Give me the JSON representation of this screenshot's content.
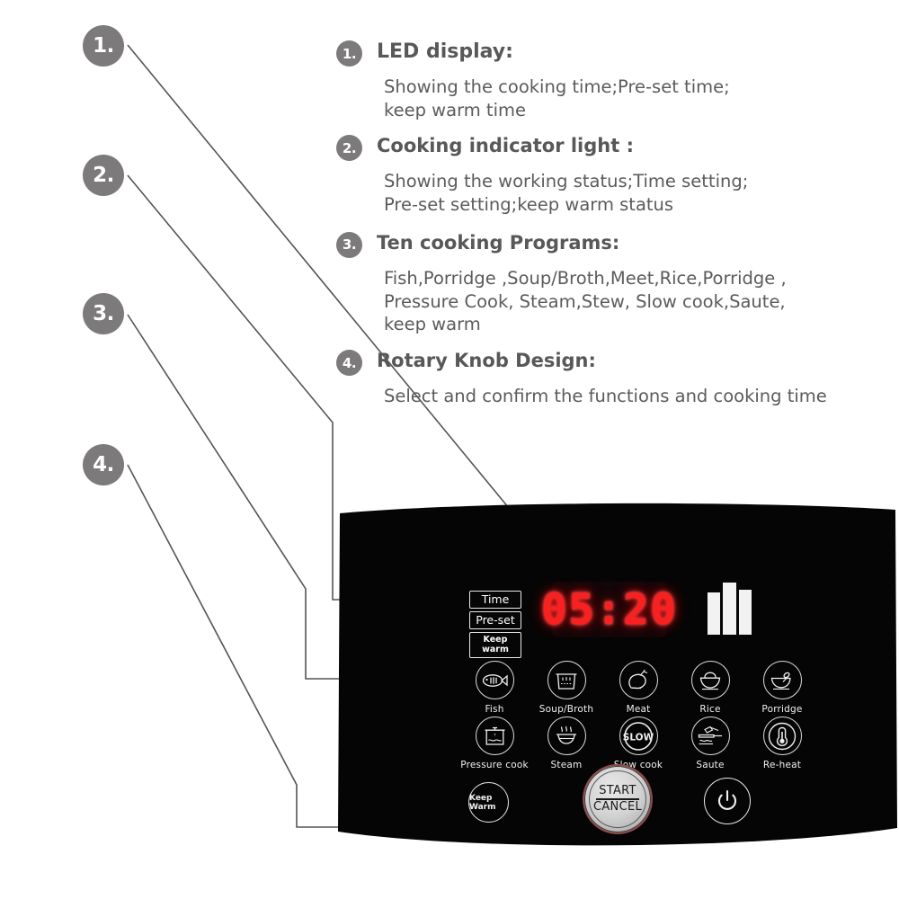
{
  "markers": [
    {
      "id": "marker-1",
      "label": "1."
    },
    {
      "id": "marker-2",
      "label": "2."
    },
    {
      "id": "marker-3",
      "label": "3."
    },
    {
      "id": "marker-4",
      "label": "4."
    }
  ],
  "features": [
    {
      "number": "1.",
      "title": "LED display:",
      "description": "Showing the cooking time;Pre-set time;\nkeep warm time"
    },
    {
      "number": "2.",
      "title": "Cooking indicator light :",
      "description": "Showing the  working status;Time setting;\nPre-set setting;keep warm status"
    },
    {
      "number": "3.",
      "title": "Ten cooking  Programs:",
      "description": "Fish,Porridge ,Soup/Broth,Meet,Rice,Porridge ,\nPressure Cook, Steam,Stew, Slow cook,Saute,\nkeep warm"
    },
    {
      "number": "4.",
      "title": "Rotary Knob Design:",
      "description": "Select and confirm the functions and cooking time"
    }
  ],
  "panel": {
    "indicators": [
      {
        "label": "Time",
        "name": "indicator-time"
      },
      {
        "label": "Pre-set",
        "name": "indicator-pre-set"
      },
      {
        "label": "Keep warm",
        "name": "indicator-keep-warm"
      }
    ],
    "led_display": {
      "value": "05:20",
      "color": "#fb2020"
    },
    "pressure_bars": {
      "name": "pressure-level-indicator",
      "bars": 3,
      "color": "#f2f2f2"
    },
    "programs_row1": [
      {
        "label": "Fish",
        "icon": "fish-icon"
      },
      {
        "label": "Soup/Broth",
        "icon": "soup-pot-icon"
      },
      {
        "label": "Meat",
        "icon": "meat-drumstick-icon"
      },
      {
        "label": "Rice",
        "icon": "rice-bowl-icon"
      },
      {
        "label": "Porridge",
        "icon": "porridge-bowl-spoon-icon"
      }
    ],
    "programs_row2": [
      {
        "label": "Pressure cook",
        "icon": "pressure-cooker-icon"
      },
      {
        "label": "Steam",
        "icon": "steam-pot-icon"
      },
      {
        "label": "Slow cook",
        "icon": "slow-icon",
        "icon_text": "SLOW"
      },
      {
        "label": "Saute",
        "icon": "saute-pan-icon"
      },
      {
        "label": "Re-heat",
        "icon": "thermometer-icon"
      }
    ],
    "keep_warm_button": {
      "label": "Keep Warm",
      "name": "keep-warm-button"
    },
    "start_cancel_knob": {
      "top_label": "START",
      "bottom_label": "CANCEL",
      "name": "start-cancel-knob",
      "ring_color": "#8e4a4a"
    },
    "power_button": {
      "name": "power-button",
      "icon": "power-icon"
    }
  },
  "colors": {
    "marker_gray": "#7c7a7b",
    "text_gray": "#585858",
    "panel_black": "#050505",
    "led_red": "#fb2020",
    "leader_line": "#555555"
  }
}
